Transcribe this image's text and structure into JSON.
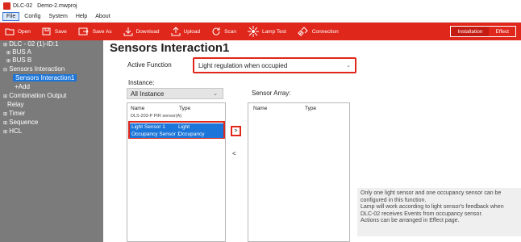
{
  "window": {
    "title": "DLC-02",
    "project": "Demo-2.mwproj"
  },
  "menu": [
    "File",
    "Config",
    "System",
    "Help",
    "About"
  ],
  "toolbar": {
    "buttons": [
      "Open",
      "Save",
      "Save As",
      "Download",
      "Upload",
      "Scan",
      "Lamp Test",
      "Connection"
    ],
    "modes": [
      "Installation",
      "Effect"
    ],
    "active_mode": "Installation",
    "accent_color": "#e0271b"
  },
  "sidebar": {
    "items": [
      "DLC - 02 (1)-ID:1",
      "BUS A",
      "BUS B",
      "Sensors Interaction",
      "Sensors Interaction1",
      "+Add",
      "Combination Output",
      "Relay",
      "Timer",
      "Sequence",
      "HCL"
    ]
  },
  "main": {
    "title": "Sensors Interaction1",
    "active_function_label": "Active Function",
    "active_function_value": "Light regulation when occupied",
    "instance_label": "Instance:",
    "instance_value": "All Instance",
    "sensor_array_label": "Sensor Array:",
    "instance_list": {
      "columns": [
        "Name",
        "Type"
      ],
      "group": "DLS-203-P PIR sensor(A)",
      "rows": [
        {
          "name": "Light Sensor 1",
          "type": "Light"
        },
        {
          "name": "Occupancy Sensor 1",
          "type": "Occupancy"
        }
      ]
    },
    "sensor_array_list": {
      "columns": [
        "Name",
        "Type"
      ]
    },
    "move_right": ">",
    "move_left": "<",
    "info": [
      "Only one light sensor and one  occupancy sensor can be",
      "configured in this function.",
      "Lamp will work according to light sensor's feedback when",
      "DLC-02 receives Events from occupancy sensor.",
      "Actions can be arranged in Effect page."
    ]
  }
}
